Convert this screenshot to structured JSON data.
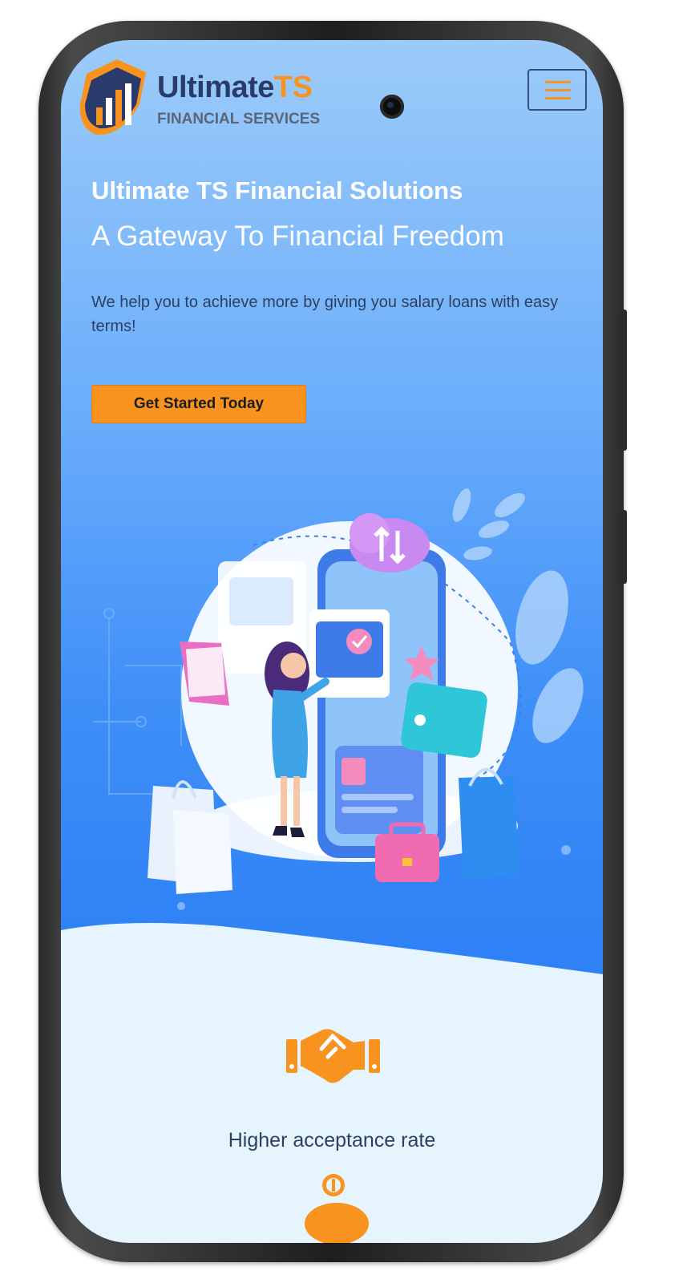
{
  "header": {
    "brand_name": "Ultimate",
    "brand_accent": "TS",
    "brand_tagline": "FINANCIAL SERVICES",
    "menu_icon": "hamburger-menu-icon"
  },
  "hero": {
    "title": "Ultimate TS Financial Solutions",
    "subtitle": "A Gateway To Financial Freedom",
    "description": "We help you to achieve more by giving you salary loans with easy terms!",
    "cta_label": "Get Started Today"
  },
  "features": [
    {
      "icon": "handshake-icon",
      "label": "Higher acceptance rate"
    },
    {
      "icon": "piggy-bank-icon",
      "label": ""
    }
  ],
  "colors": {
    "accent": "#f7931e",
    "brand_navy": "#2a3b6b",
    "hero_blue": "#2f82f5",
    "section_bg": "#e6f4fd"
  }
}
